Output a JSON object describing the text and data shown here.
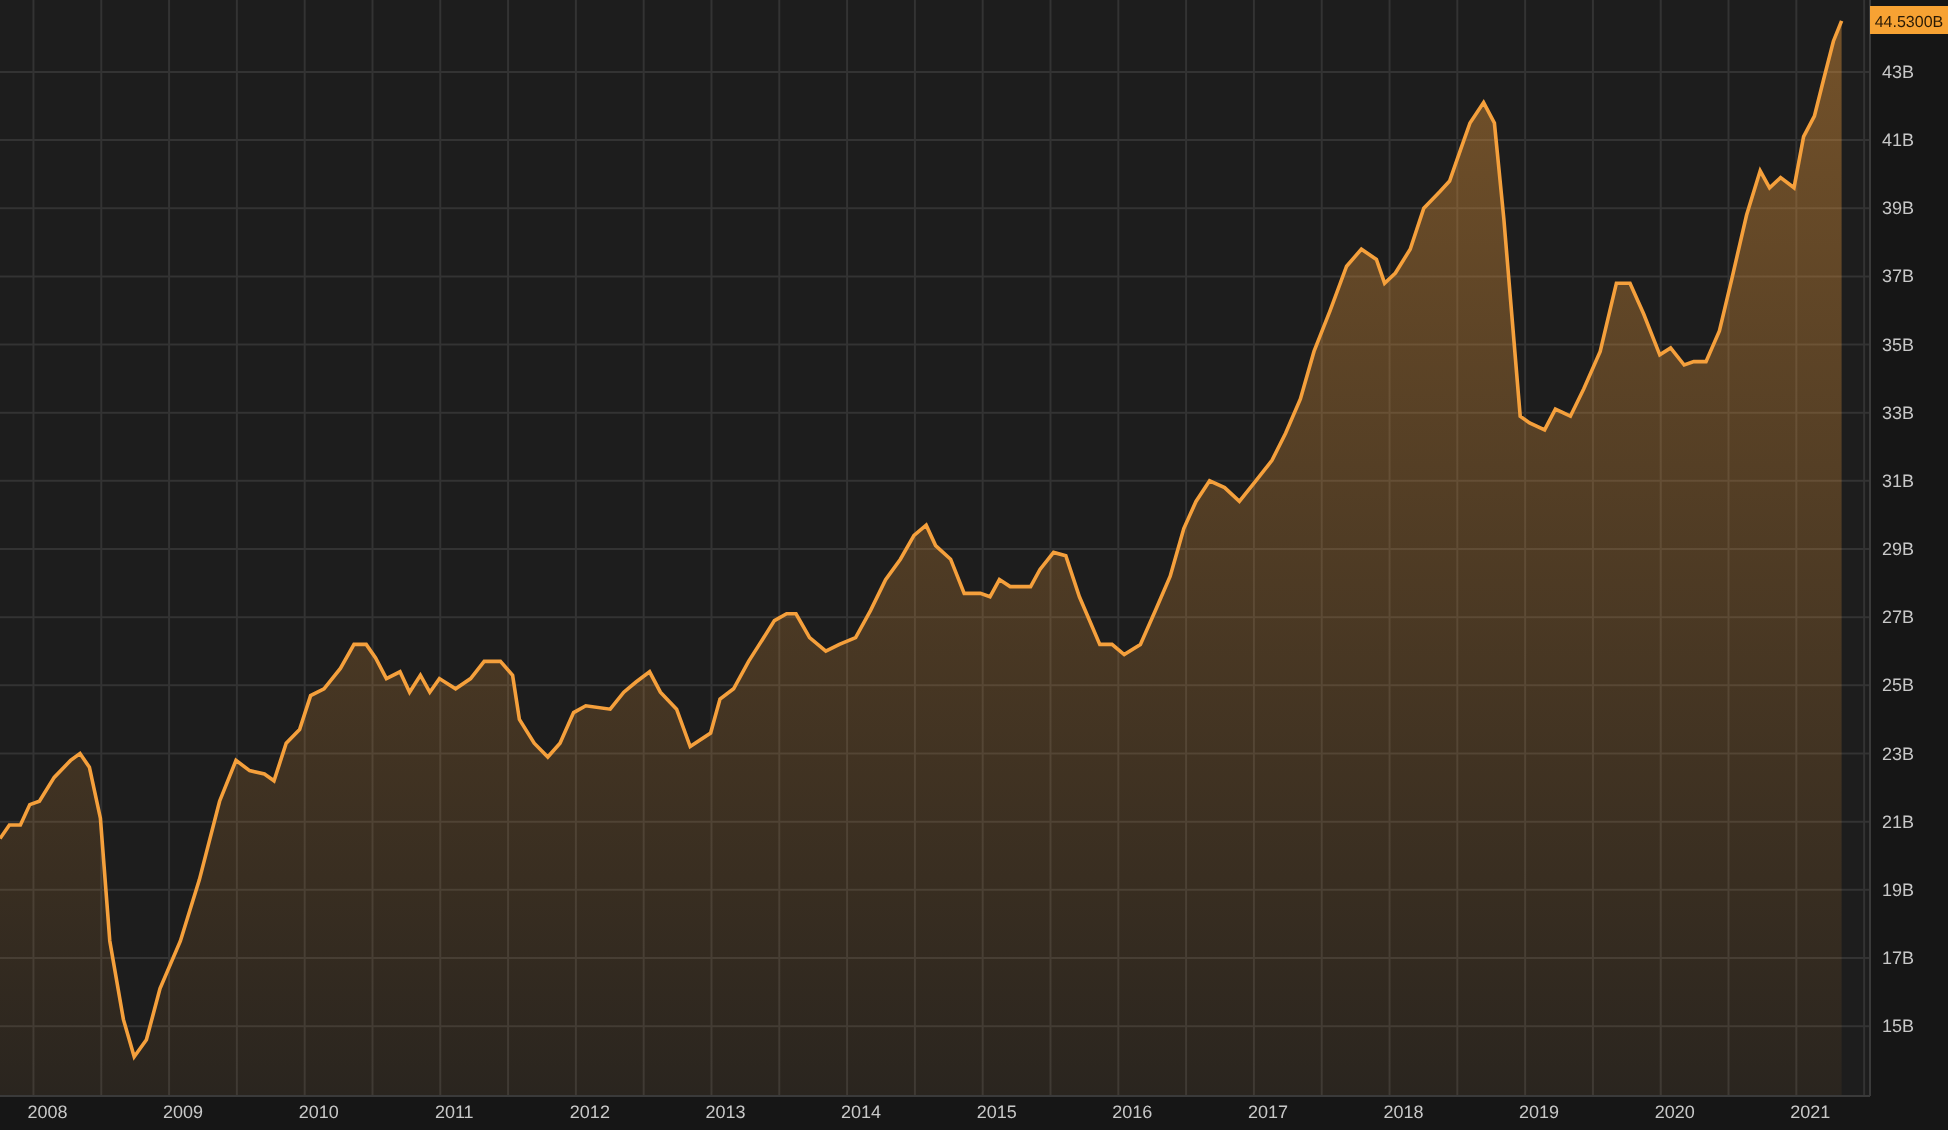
{
  "chart": {
    "last_price_label": "44.5300B",
    "chart_data": {
      "type": "area",
      "xlim": [
        2007.65,
        2021.44
      ],
      "ylim": [
        12.95,
        45.11
      ],
      "grid": true,
      "x": [
        2007.65,
        2007.72,
        2007.8,
        2007.87,
        2007.94,
        2008.05,
        2008.17,
        2008.24,
        2008.31,
        2008.39,
        2008.46,
        2008.56,
        2008.64,
        2008.73,
        2008.83,
        2008.98,
        2009.12,
        2009.27,
        2009.39,
        2009.49,
        2009.6,
        2009.67,
        2009.76,
        2009.86,
        2009.94,
        2010.04,
        2010.16,
        2010.26,
        2010.35,
        2010.42,
        2010.5,
        2010.6,
        2010.67,
        2010.75,
        2010.82,
        2010.89,
        2011.01,
        2011.12,
        2011.22,
        2011.34,
        2011.43,
        2011.48,
        2011.59,
        2011.69,
        2011.78,
        2011.88,
        2011.97,
        2012.15,
        2012.25,
        2012.34,
        2012.44,
        2012.52,
        2012.64,
        2012.74,
        2012.89,
        2012.96,
        2013.06,
        2013.17,
        2013.25,
        2013.36,
        2013.45,
        2013.52,
        2013.62,
        2013.74,
        2013.84,
        2013.96,
        2014.07,
        2014.18,
        2014.29,
        2014.39,
        2014.48,
        2014.55,
        2014.66,
        2014.76,
        2014.88,
        2014.95,
        2015.02,
        2015.1,
        2015.25,
        2015.32,
        2015.42,
        2015.51,
        2015.61,
        2015.76,
        2015.85,
        2015.94,
        2016.06,
        2016.17,
        2016.28,
        2016.38,
        2016.47,
        2016.57,
        2016.68,
        2016.79,
        2016.91,
        2017.03,
        2017.13,
        2017.24,
        2017.34,
        2017.46,
        2017.58,
        2017.69,
        2017.8,
        2017.86,
        2017.94,
        2018.05,
        2018.15,
        2018.27,
        2018.34,
        2018.42,
        2018.49,
        2018.59,
        2018.67,
        2018.74,
        2018.86,
        2018.93,
        2019.04,
        2019.12,
        2019.23,
        2019.33,
        2019.45,
        2019.57,
        2019.67,
        2019.77,
        2019.89,
        2019.97,
        2020.07,
        2020.14,
        2020.23,
        2020.33,
        2020.42,
        2020.53,
        2020.63,
        2020.7,
        2020.78,
        2020.88,
        2020.95,
        2021.03,
        2021.1,
        2021.17,
        2021.23
      ],
      "series": [
        {
          "color": "#f5a03c",
          "values": [
            20.5,
            20.9,
            20.9,
            21.5,
            21.6,
            22.3,
            22.8,
            23.0,
            22.6,
            21.1,
            17.5,
            15.2,
            14.1,
            14.6,
            16.1,
            17.5,
            19.3,
            21.6,
            22.8,
            22.5,
            22.4,
            22.2,
            23.3,
            23.7,
            24.7,
            24.9,
            25.5,
            26.2,
            26.2,
            25.8,
            25.2,
            25.4,
            24.8,
            25.3,
            24.8,
            25.2,
            24.9,
            25.2,
            25.7,
            25.7,
            25.3,
            24.0,
            23.3,
            22.9,
            23.3,
            24.2,
            24.4,
            24.3,
            24.8,
            25.1,
            25.4,
            24.8,
            24.3,
            23.2,
            23.6,
            24.6,
            24.9,
            25.7,
            26.2,
            26.9,
            27.1,
            27.1,
            26.4,
            26.0,
            26.2,
            26.4,
            27.2,
            28.1,
            28.7,
            29.4,
            29.7,
            29.1,
            28.7,
            27.7,
            27.7,
            27.6,
            28.1,
            27.9,
            27.9,
            28.4,
            28.9,
            28.8,
            27.6,
            26.2,
            26.2,
            25.9,
            26.2,
            27.2,
            28.2,
            29.6,
            30.4,
            31.0,
            30.8,
            30.4,
            31.0,
            31.6,
            32.4,
            33.4,
            34.8,
            36.0,
            37.3,
            37.8,
            37.5,
            36.8,
            37.1,
            37.8,
            39.0,
            39.5,
            39.8,
            40.7,
            41.5,
            42.1,
            41.5,
            38.7,
            32.9,
            32.7,
            32.5,
            33.1,
            32.9,
            33.7,
            34.8,
            36.8,
            36.8,
            35.9,
            34.7,
            34.9,
            34.4,
            34.5,
            34.5,
            35.4,
            36.9,
            38.8,
            40.1,
            39.6,
            39.9,
            39.6,
            41.1,
            41.7,
            42.8,
            43.9,
            44.5
          ]
        }
      ],
      "xticks": [
        {
          "value": 2008,
          "label": "2008"
        },
        {
          "value": 2009,
          "label": "2009"
        },
        {
          "value": 2010,
          "label": "2010"
        },
        {
          "value": 2011,
          "label": "2011"
        },
        {
          "value": 2012,
          "label": "2012"
        },
        {
          "value": 2013,
          "label": "2013"
        },
        {
          "value": 2014,
          "label": "2014"
        },
        {
          "value": 2015,
          "label": "2015"
        },
        {
          "value": 2016,
          "label": "2016"
        },
        {
          "value": 2017,
          "label": "2017"
        },
        {
          "value": 2018,
          "label": "2018"
        },
        {
          "value": 2019,
          "label": "2019"
        },
        {
          "value": 2020,
          "label": "2020"
        },
        {
          "value": 2021,
          "label": "2021"
        }
      ],
      "yticks": [
        {
          "value": 15,
          "label": "15B"
        },
        {
          "value": 17,
          "label": "17B"
        },
        {
          "value": 19,
          "label": "19B"
        },
        {
          "value": 21,
          "label": "21B"
        },
        {
          "value": 23,
          "label": "23B"
        },
        {
          "value": 25,
          "label": "25B"
        },
        {
          "value": 27,
          "label": "27B"
        },
        {
          "value": 29,
          "label": "29B"
        },
        {
          "value": 31,
          "label": "31B"
        },
        {
          "value": 33,
          "label": "33B"
        },
        {
          "value": 35,
          "label": "35B"
        },
        {
          "value": 37,
          "label": "37B"
        },
        {
          "value": 39,
          "label": "39B"
        },
        {
          "value": 41,
          "label": "41B"
        },
        {
          "value": 43,
          "label": "43B"
        }
      ]
    }
  }
}
